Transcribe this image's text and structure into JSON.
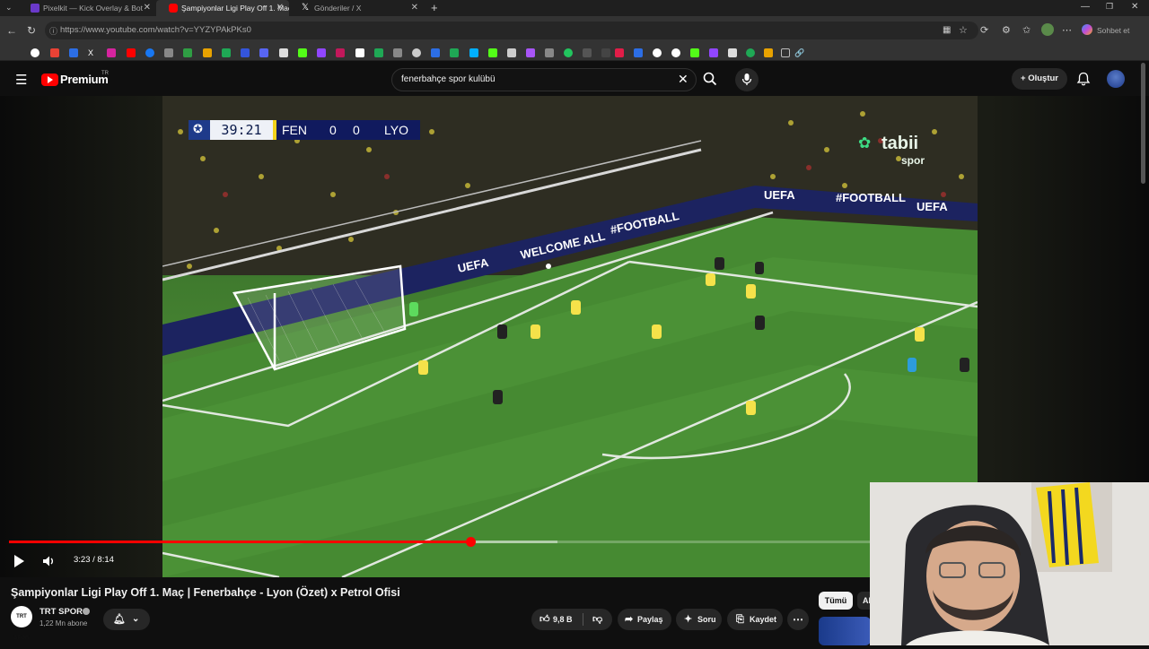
{
  "browser": {
    "tabs": [
      {
        "title": "Pixelkit — Kick Overlay & Bot",
        "favicon_color": "#6a39c9"
      },
      {
        "title": "Şampiyonlar Ligi Play Off 1. Maç |",
        "favicon_color": "#ff0000"
      },
      {
        "title": "Gönderiler / X",
        "favicon_color": "#ffffff"
      }
    ],
    "url": "https://www.youtube.com/watch?v=YYZYPAkPKs0",
    "sohbet_label": "Sohbet et"
  },
  "youtube": {
    "logo_text": "Premium",
    "logo_badge": "TR",
    "search_value": "fenerbahçe spor kulübü",
    "create_label": "Oluştur"
  },
  "video": {
    "scorebug": {
      "time": "39:21",
      "home": "FEN",
      "home_score": "0",
      "away_score": "0",
      "away": "LYO"
    },
    "watermark_top": "tabii",
    "watermark_bottom": "spor",
    "ads": [
      "WELCOME ALL",
      "UEFA",
      "#FOOTBALL"
    ],
    "progress": 0.408,
    "buffered": 0.485,
    "time_display": "3:23 / 8:14"
  },
  "info": {
    "title": "Şampiyonlar Ligi Play Off 1. Maç | Fenerbahçe - Lyon (Özet) x Petrol Ofisi",
    "channel_name": "TRT SPOR",
    "channel_avatar_text": "TRT SPOR",
    "subscribers": "1,22 Mn abone",
    "likes": "9,8 B",
    "share": "Paylaş",
    "ask": "Soru",
    "save": "Kaydet"
  },
  "sidebar": {
    "filter_all": "Tümü",
    "filter_next": "Al"
  },
  "colors": {
    "accent": "#ff0000",
    "bg": "#0f0f0f",
    "pill": "#272727"
  }
}
